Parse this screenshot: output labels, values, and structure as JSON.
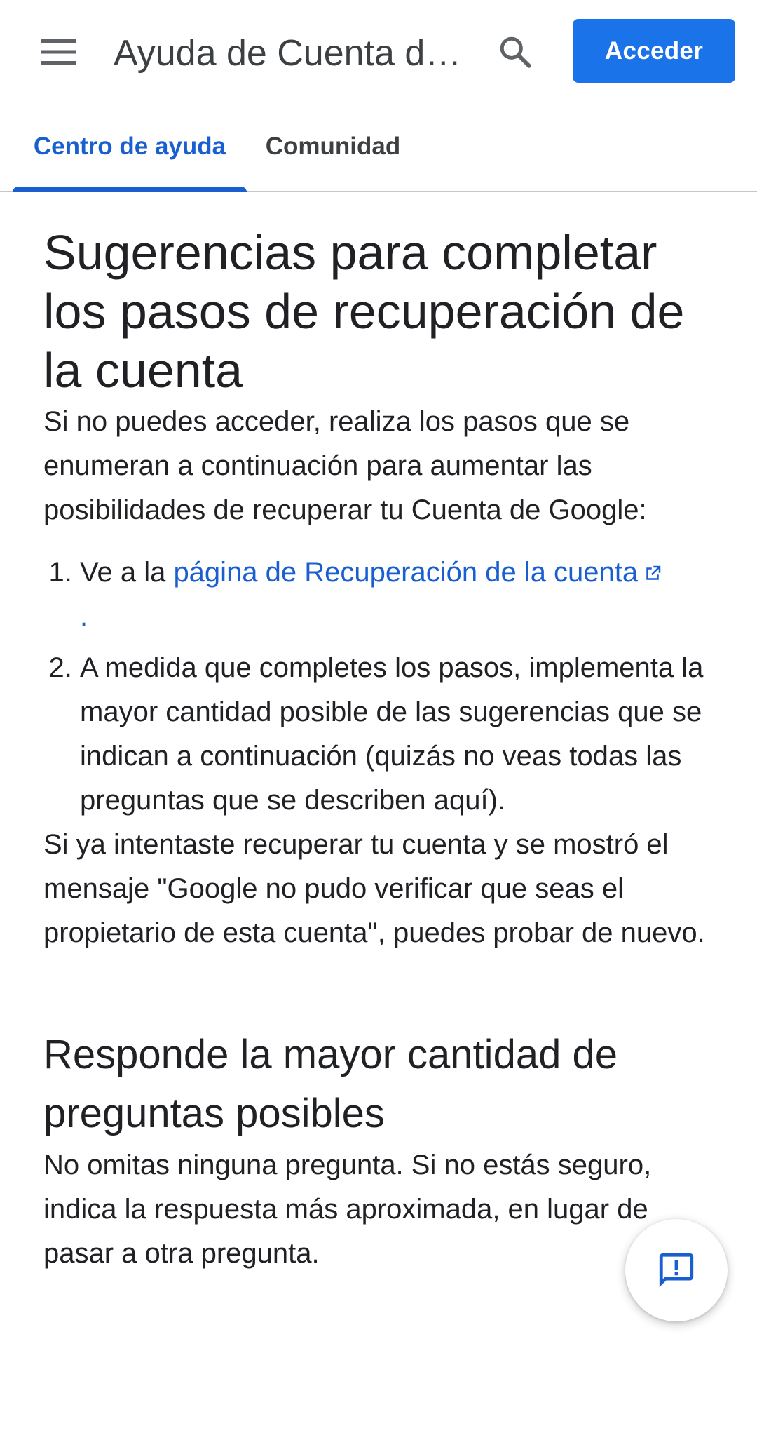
{
  "header": {
    "title": "Ayuda de Cuenta de…",
    "signin_label": "Acceder",
    "menu_icon": "menu-icon",
    "search_icon": "search-icon"
  },
  "tabs": [
    {
      "label": "Centro de ayuda",
      "active": true
    },
    {
      "label": "Comunidad",
      "active": false
    }
  ],
  "article": {
    "title": "Sugerencias para completar los pasos de recuperación de la cuenta",
    "intro": "Si no puedes acceder, realiza los pasos que se enumeran a continuación para aumentar las posibilidades de recuperar tu Cuenta de Google:",
    "steps": [
      {
        "prefix": "Ve a la ",
        "link": "página de Recuperación de la cuenta",
        "suffix": "."
      },
      {
        "text": "A medida que completes los pasos, implementa la mayor cantidad posible de las sugerencias que se indican a continuación (quizás no veas todas las preguntas que se describen aquí)."
      }
    ],
    "after_steps": "Si ya intentaste recuperar tu cuenta y se mostró el mensaje \"Google no pudo verificar que seas el propietario de esta cuenta\", puedes probar de nuevo.",
    "section": {
      "title": "Responde la mayor cantidad de preguntas posibles",
      "body": "No omitas ninguna pregunta. Si no estás seguro, indica la respuesta más aproximada, en lugar de pasar a otra pregunta."
    }
  },
  "fab": {
    "icon": "feedback-icon"
  },
  "colors": {
    "accent": "#1a73e8",
    "link": "#1a5fd0",
    "text": "#202124"
  }
}
